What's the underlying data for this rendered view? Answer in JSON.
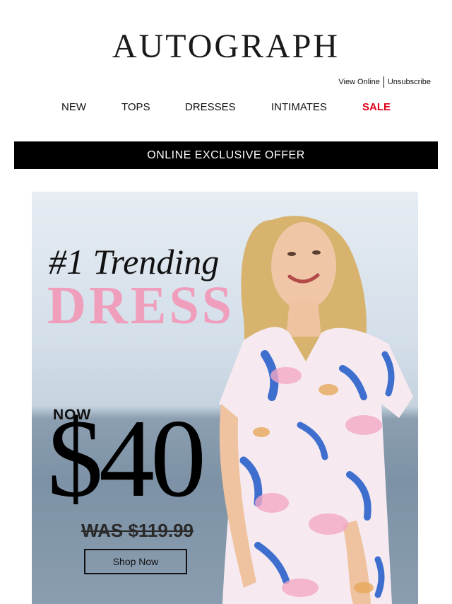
{
  "brand": {
    "logo": "AUTOGRAPH"
  },
  "utility_links": {
    "view_online": "View Online",
    "unsubscribe": "Unsubscribe"
  },
  "nav": {
    "items": [
      {
        "label": "NEW"
      },
      {
        "label": "TOPS"
      },
      {
        "label": "DRESSES"
      },
      {
        "label": "INTIMATES"
      },
      {
        "label": "SALE"
      }
    ],
    "sale_color": "#e0001b"
  },
  "banner": {
    "text": "ONLINE EXCLUSIVE OFFER"
  },
  "hero": {
    "headline_1": "#1 Trending",
    "headline_2": "DRESS",
    "now_label": "NOW",
    "price": "$40",
    "was_price": "WAS $119.99",
    "cta": "Shop Now",
    "accent_pink": "#ef9ebc"
  }
}
